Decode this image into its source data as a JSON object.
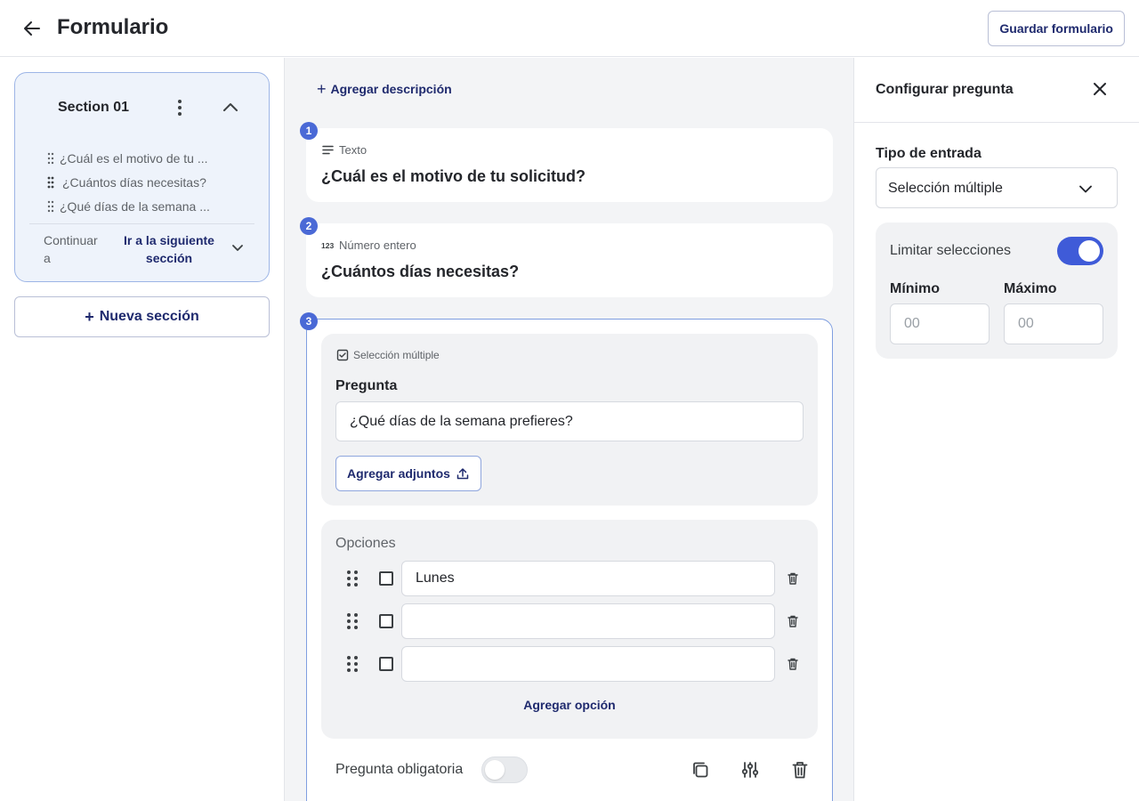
{
  "header": {
    "title": "Formulario",
    "save_label": "Guardar formulario"
  },
  "sidebar": {
    "section": {
      "title": "Section 01",
      "questions": [
        {
          "label": "¿Cuál es el motivo de tu ..."
        },
        {
          "label": "¿Cuántos días necesitas?"
        },
        {
          "label": "¿Qué días de la semana ..."
        }
      ],
      "continue_label": "Continuar a",
      "continue_value": "Ir a la siguiente sección"
    },
    "new_section_label": "Nueva sección"
  },
  "editor": {
    "add_description_label": "Agregar descripción",
    "questions": [
      {
        "number": "1",
        "type": "Texto",
        "title": "¿Cuál es el motivo de tu solicitud?"
      },
      {
        "number": "2",
        "type": "Número entero",
        "title": "¿Cuántos días necesitas?"
      },
      {
        "number": "3",
        "type": "Selección múltiple",
        "question_label": "Pregunta",
        "question_value": "¿Qué días de la semana prefieres?",
        "attach_label": "Agregar adjuntos",
        "options_label": "Opciones",
        "options": [
          {
            "value": "Lunes"
          },
          {
            "value": ""
          },
          {
            "value": ""
          }
        ],
        "add_option_label": "Agregar opción",
        "required_label": "Pregunta obligatoria",
        "required": false
      }
    ]
  },
  "config": {
    "title": "Configurar pregunta",
    "input_type_label": "Tipo de entrada",
    "input_type_value": "Selección múltiple",
    "limit_label": "Limitar selecciones",
    "limit_enabled": true,
    "min_label": "Mínimo",
    "min_placeholder": "00",
    "max_label": "Máximo",
    "max_placeholder": "00"
  },
  "colors": {
    "accent": "#3f5bd8",
    "badge": "#4a69d6",
    "link": "#1f2a6e",
    "section_bg": "#eef3fb",
    "canvas_bg": "#f3f4f6"
  },
  "icons": {
    "back": "arrow-left-icon",
    "kebab": "more-vertical-icon",
    "collapse": "chevron-up-icon",
    "drag": "drag-handle-icon",
    "text_type": "text-lines-icon",
    "number_type": "number-123-icon",
    "multi_type": "checkbox-icon",
    "upload": "upload-icon",
    "trash": "trash-icon",
    "duplicate": "copy-icon",
    "settings": "sliders-icon",
    "close": "close-icon"
  }
}
